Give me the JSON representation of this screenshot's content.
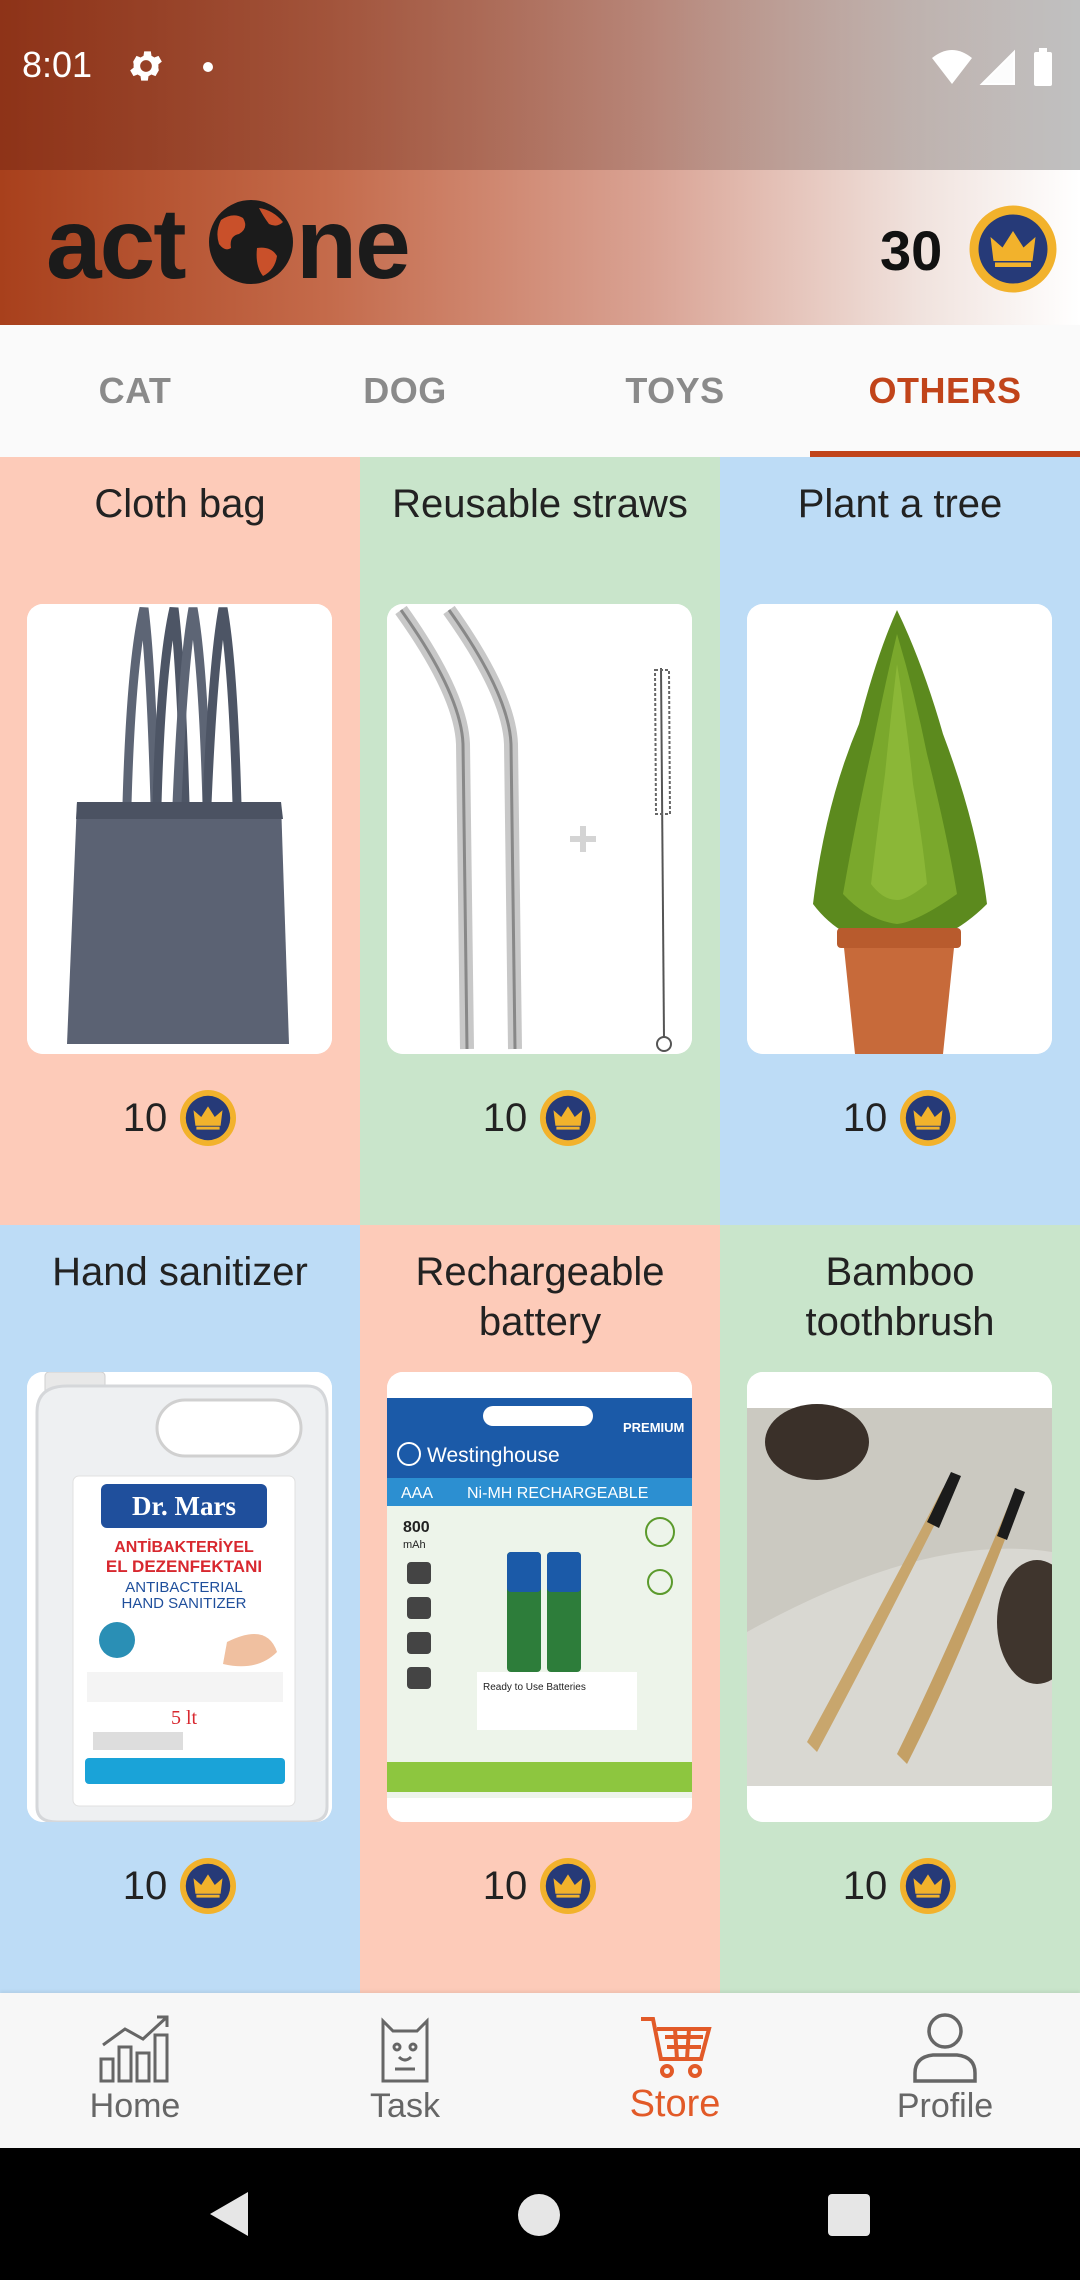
{
  "status_bar": {
    "time": "8:01",
    "icons": [
      "gear-icon",
      "dot-icon",
      "wifi-icon",
      "signal-icon",
      "battery-icon"
    ]
  },
  "header": {
    "logo_text": "actone",
    "coin_balance": "30",
    "coin_icon": "crown-coin-icon"
  },
  "tabs": [
    {
      "label": "CAT",
      "active": false
    },
    {
      "label": "DOG",
      "active": false
    },
    {
      "label": "TOYS",
      "active": false
    },
    {
      "label": "OTHERS",
      "active": true
    }
  ],
  "products": [
    {
      "title": "Cloth bag",
      "price": "10",
      "image": "cloth-bag"
    },
    {
      "title": "Reusable straws",
      "price": "10",
      "image": "straws"
    },
    {
      "title": "Plant a tree",
      "price": "10",
      "image": "tree"
    },
    {
      "title": "Hand sanitizer",
      "price": "10",
      "image": "sanitizer"
    },
    {
      "title": "Rechargeable battery",
      "price": "10",
      "image": "battery"
    },
    {
      "title": "Bamboo toothbrush",
      "price": "10",
      "image": "toothbrush"
    }
  ],
  "product_image_text": {
    "sanitizer": {
      "brand": "Dr. Mars",
      "line1": "ANTİBAKTERİYEL",
      "line2": "EL DEZENFEKTANI",
      "line3": "ANTIBACTERIAL",
      "line4": "HAND SANITIZER",
      "volume": "5 lt"
    },
    "battery": {
      "brand": "Westinghouse",
      "badge": "PREMIUM",
      "size": "AAA",
      "type": "Ni-MH RECHARGEABLE",
      "capacity": "800",
      "unit": "mAh",
      "ready": "Ready to Use Batteries"
    }
  },
  "bottom_nav": [
    {
      "label": "Home",
      "icon": "chart-icon",
      "active": false
    },
    {
      "label": "Task",
      "icon": "task-icon",
      "active": false
    },
    {
      "label": "Store",
      "icon": "cart-icon",
      "active": true
    },
    {
      "label": "Profile",
      "icon": "profile-icon",
      "active": false
    }
  ],
  "colors": {
    "accent": "#c1441a",
    "store_active": "#e25a28",
    "peach": "#fdcbb9",
    "mint": "#c9e5cb",
    "sky": "#bddcf6",
    "coin_navy": "#263a78",
    "coin_gold": "#f2b22c"
  }
}
